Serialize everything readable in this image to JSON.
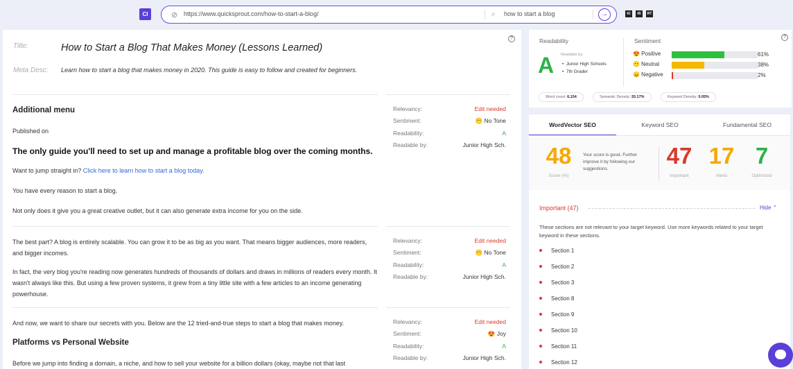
{
  "toolbar": {
    "logo": "CI",
    "url": "https://www.quicksprout.com/how-to-start-a-blog/",
    "keyword": "how to start a blog",
    "mini_icons": [
      "KI",
      "RI",
      "RT"
    ]
  },
  "meta": {
    "title_label": "Title:",
    "title": "How to Start a Blog That Makes Money (Lessons Learned)",
    "desc_label": "Meta Desc:",
    "desc": "Learn how to start a blog that makes money in 2020. This guide is easy to follow and created for beginners."
  },
  "content": {
    "s1_heading": "Additional menu",
    "s1_published": "Published on",
    "s1_h1": "The only guide you'll need to set up and manage a profitable blog over the coming months.",
    "s1_p1_pre": "Want to jump straight in? ",
    "s1_p1_link": "Click here to learn how to start a blog today.",
    "s1_p2": "You have every reason to start a blog.",
    "s1_p3": "Not only does it give you a great creative outlet, but it can also generate extra income for you on the side.",
    "s2_p1": "The best part? A blog is entirely scalable. You can grow it to be as big as you want. That means bigger audiences, more readers, and bigger incomes.",
    "s2_p2": "In fact, the very blog you're reading now generates hundreds of thousands of dollars and draws in millions of readers every month. It wasn't always like this. But using a few proven systems, it grew from a tiny little site with a few articles to an income generating powerhouse.",
    "s3_p1": "And now, we want to share our secrets with you. Below are the 12 tried-and-true steps to start a blog that makes money.",
    "s3_heading": "Platforms vs Personal Website",
    "s3_p2": "Before we jump into finding a domain, a niche, and how to sell your website for a billion dollars (okay, maybe not that last"
  },
  "section_meta": [
    {
      "relevancy_label": "Relevancy:",
      "relevancy": "Edit needed",
      "sentiment_label": "Sentiment:",
      "sentiment": "😶 No Tone",
      "readability_label": "Readability:",
      "readability": "A",
      "readable_by_label": "Readable by:",
      "readable_by": "Junior High Sch."
    },
    {
      "relevancy_label": "Relevancy:",
      "relevancy": "Edit needed",
      "sentiment_label": "Sentiment:",
      "sentiment": "😶 No Tone",
      "readability_label": "Readability:",
      "readability": "A",
      "readable_by_label": "Readable by:",
      "readable_by": "Junior High Sch."
    },
    {
      "relevancy_label": "Relevancy:",
      "relevancy": "Edit needed",
      "sentiment_label": "Sentiment:",
      "sentiment": "😍 Joy",
      "readability_label": "Readability:",
      "readability": "A",
      "readable_by_label": "Readable by:",
      "readable_by": "Junior High Sch."
    }
  ],
  "readability": {
    "label": "Readability",
    "grade": "A",
    "readable_by_label": "Readable by:",
    "readable_by": [
      "Junior High Schools",
      "7th Grader"
    ]
  },
  "sentiment": {
    "label": "Sentiment",
    "rows": [
      {
        "name": "😍 Positive",
        "percent": 61,
        "pct_text": "61%",
        "color": "#2fc13e"
      },
      {
        "name": "😶 Neutral",
        "percent": 38,
        "pct_text": "38%",
        "color": "#f5b700"
      },
      {
        "name": "😠 Negative",
        "percent": 2,
        "pct_text": "2%",
        "color": "#e0342a"
      }
    ]
  },
  "stats": {
    "word_count_label": "Word count:",
    "word_count": "6,154",
    "semantic_label": "Semantic Density:",
    "semantic": "20.17%",
    "keyword_label": "Keyword Density:",
    "keyword": "0.05%"
  },
  "seo": {
    "tabs": [
      "WordVector SEO",
      "Keyword SEO",
      "Fundamental SEO"
    ],
    "score": "48",
    "score_label": "Score (%)",
    "score_desc": "Your score is good. Further improve it by following our suggestions.",
    "important": "47",
    "important_label": "Important",
    "alerts": "17",
    "alerts_label": "Alerts",
    "optimized": "7",
    "optimized_label": "Optimized",
    "important_title": "Important (47)",
    "hide": "Hide ⌃",
    "important_desc": "These sections are not relevant to your target keyword. Use more keywords related to your target keyword in these sections.",
    "sections": [
      "Section 1",
      "Section 2",
      "Section 3",
      "Section 8",
      "Section 9",
      "Section 10",
      "Section 11",
      "Section 12"
    ]
  },
  "colors": {
    "accent": "#5b3fd6",
    "red": "#d93a2b",
    "orange": "#f5a800",
    "green": "#2fb24a"
  }
}
